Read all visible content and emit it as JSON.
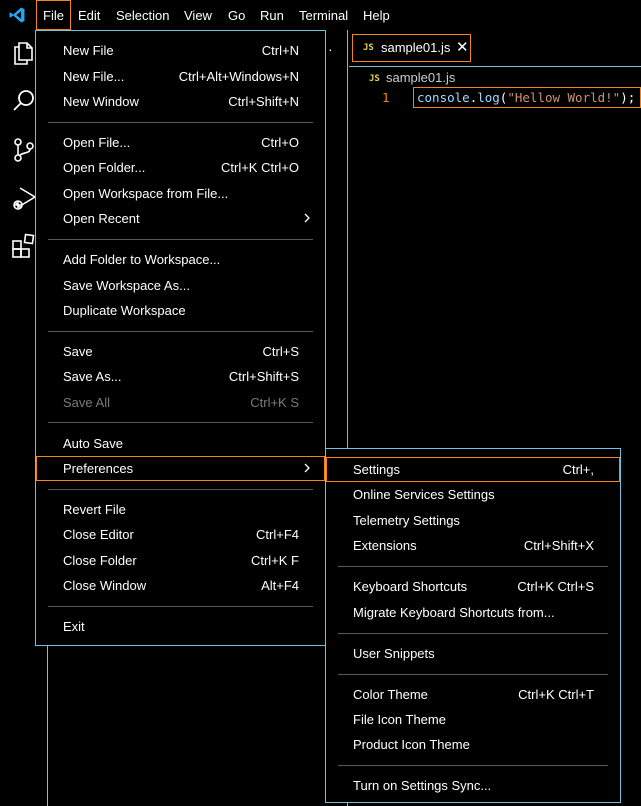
{
  "menubar": {
    "items": [
      "File",
      "Edit",
      "Selection",
      "View",
      "Go",
      "Run",
      "Terminal",
      "Help"
    ],
    "active": "File"
  },
  "activity_bar": {
    "icons": [
      "explorer-icon",
      "search-icon",
      "source-control-icon",
      "run-debug-icon",
      "extensions-icon"
    ]
  },
  "editor": {
    "tab": {
      "badge": "JS",
      "label": "sample01.js"
    },
    "breadcrumb": {
      "badge": "JS",
      "label": "sample01.js"
    },
    "line_number": "1",
    "code": {
      "ident": "console",
      "dot": ".",
      "method": "log",
      "open": "(",
      "string": "\"Hellow World!\"",
      "close": ");"
    }
  },
  "file_menu": {
    "new_file": {
      "label": "New File",
      "shortcut": "Ctrl+N"
    },
    "new_file_ellipsis": {
      "label": "New File...",
      "shortcut": "Ctrl+Alt+Windows+N"
    },
    "new_window": {
      "label": "New Window",
      "shortcut": "Ctrl+Shift+N"
    },
    "open_file": {
      "label": "Open File...",
      "shortcut": "Ctrl+O"
    },
    "open_folder": {
      "label": "Open Folder...",
      "shortcut": "Ctrl+K Ctrl+O"
    },
    "open_workspace": {
      "label": "Open Workspace from File..."
    },
    "open_recent": {
      "label": "Open Recent"
    },
    "add_folder": {
      "label": "Add Folder to Workspace..."
    },
    "save_workspace_as": {
      "label": "Save Workspace As..."
    },
    "duplicate_workspace": {
      "label": "Duplicate Workspace"
    },
    "save": {
      "label": "Save",
      "shortcut": "Ctrl+S"
    },
    "save_as": {
      "label": "Save As...",
      "shortcut": "Ctrl+Shift+S"
    },
    "save_all": {
      "label": "Save All",
      "shortcut": "Ctrl+K S"
    },
    "auto_save": {
      "label": "Auto Save"
    },
    "preferences": {
      "label": "Preferences"
    },
    "revert_file": {
      "label": "Revert File"
    },
    "close_editor": {
      "label": "Close Editor",
      "shortcut": "Ctrl+F4"
    },
    "close_folder": {
      "label": "Close Folder",
      "shortcut": "Ctrl+K F"
    },
    "close_window": {
      "label": "Close Window",
      "shortcut": "Alt+F4"
    },
    "exit": {
      "label": "Exit"
    }
  },
  "preferences_menu": {
    "settings": {
      "label": "Settings",
      "shortcut": "Ctrl+,"
    },
    "online_services": {
      "label": "Online Services Settings"
    },
    "telemetry": {
      "label": "Telemetry Settings"
    },
    "extensions": {
      "label": "Extensions",
      "shortcut": "Ctrl+Shift+X"
    },
    "keyboard_shortcuts": {
      "label": "Keyboard Shortcuts",
      "shortcut": "Ctrl+K Ctrl+S"
    },
    "migrate_shortcuts": {
      "label": "Migrate Keyboard Shortcuts from..."
    },
    "user_snippets": {
      "label": "User Snippets"
    },
    "color_theme": {
      "label": "Color Theme",
      "shortcut": "Ctrl+K Ctrl+T"
    },
    "file_icon_theme": {
      "label": "File Icon Theme"
    },
    "product_icon_theme": {
      "label": "Product Icon Theme"
    },
    "settings_sync": {
      "label": "Turn on Settings Sync..."
    }
  },
  "colors": {
    "background": "#000000",
    "contrast_border": "#6fc3df",
    "active_border": "#f38518",
    "disabled_text": "#7a7a7a",
    "js_badge": "#e8d44d"
  }
}
